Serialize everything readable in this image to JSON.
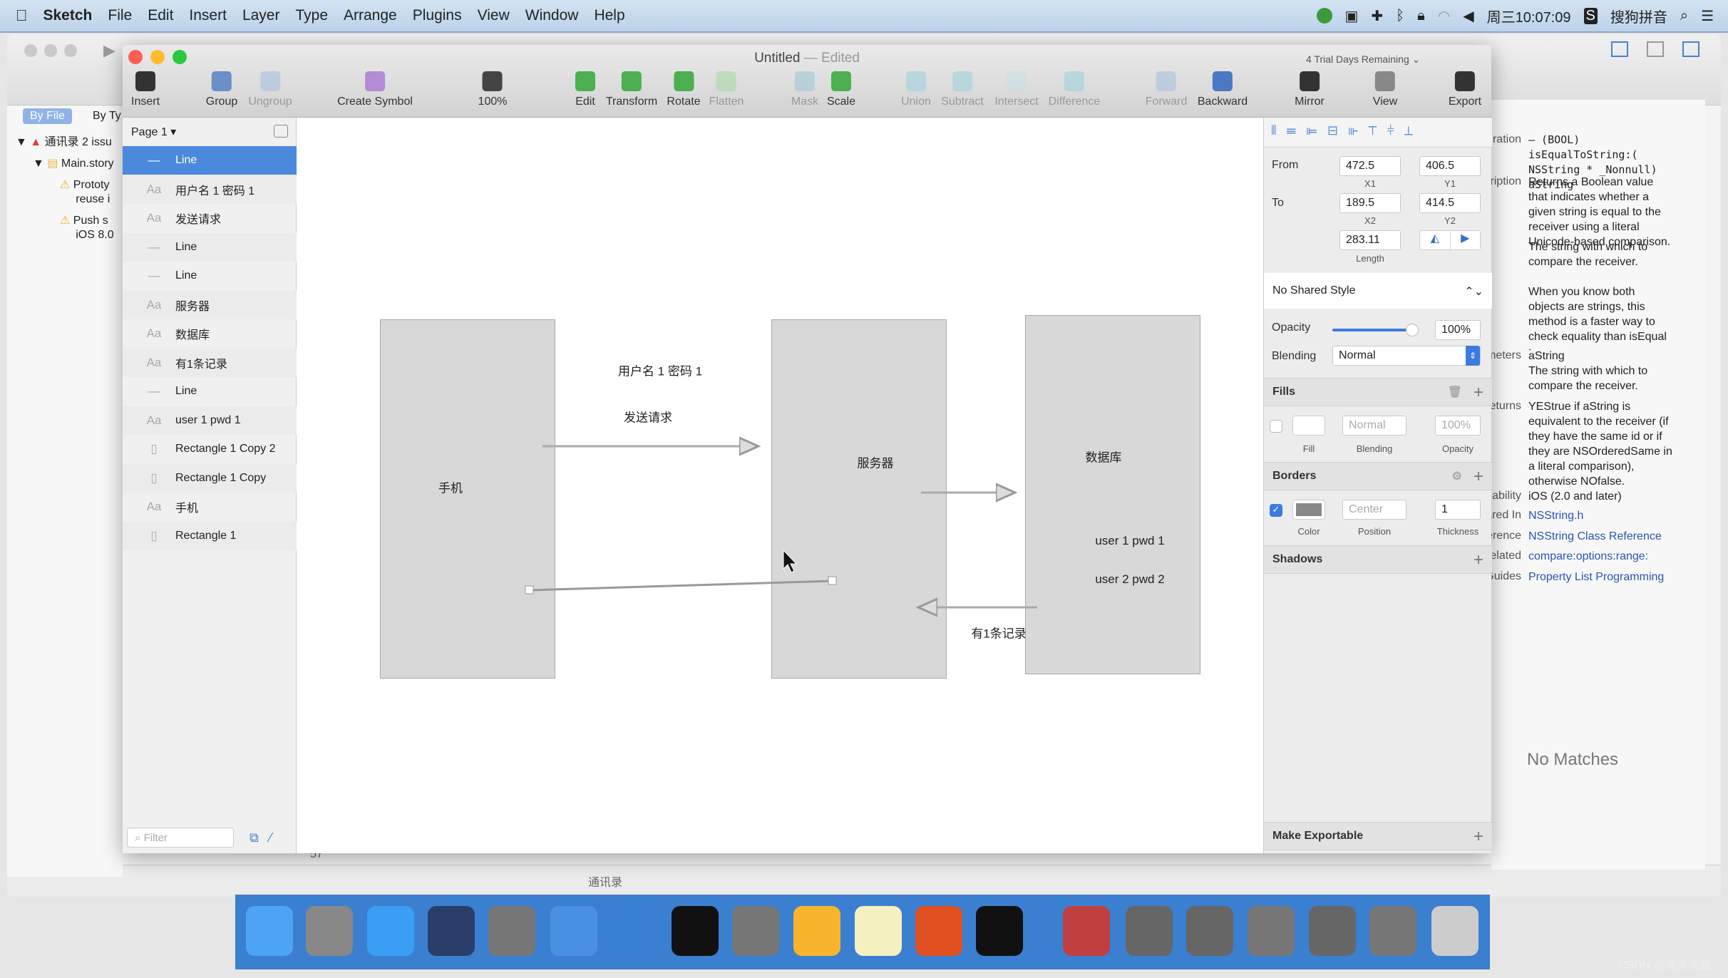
{
  "menubar": {
    "app": "Sketch",
    "items": [
      "File",
      "Edit",
      "Insert",
      "Layer",
      "Type",
      "Arrange",
      "Plugins",
      "View",
      "Window",
      "Help"
    ],
    "clock": "周三10:07:09",
    "ime": "搜狗拼音"
  },
  "window": {
    "title": "Untitled",
    "edited": "— Edited",
    "trial": "4 Trial Days Remaining"
  },
  "toolbar": [
    {
      "label": "Insert",
      "icon": "insert-icon",
      "color": "#333",
      "enabled": true
    },
    {
      "label": "Group",
      "icon": "group-icon",
      "color": "#6b8fc7",
      "enabled": true
    },
    {
      "label": "Ungroup",
      "icon": "ungroup-icon",
      "color": "#a9c0e0",
      "enabled": false
    },
    {
      "label": "Create Symbol",
      "icon": "symbol-icon",
      "color": "#b58ad6",
      "enabled": true
    },
    {
      "label": "100%",
      "icon": "zoom-icon",
      "color": "#444",
      "enabled": true
    },
    {
      "label": "Edit",
      "icon": "edit-icon",
      "color": "#4caf50",
      "enabled": true
    },
    {
      "label": "Transform",
      "icon": "transform-icon",
      "color": "#4caf50",
      "enabled": true
    },
    {
      "label": "Rotate",
      "icon": "rotate-icon",
      "color": "#4caf50",
      "enabled": true
    },
    {
      "label": "Flatten",
      "icon": "flatten-icon",
      "color": "#a8d8a8",
      "enabled": false
    },
    {
      "label": "Mask",
      "icon": "mask-icon",
      "color": "#9ec6d6",
      "enabled": false
    },
    {
      "label": "Scale",
      "icon": "scale-icon",
      "color": "#4caf50",
      "enabled": true
    },
    {
      "label": "Union",
      "icon": "union-icon",
      "color": "#9fd0dc",
      "enabled": false
    },
    {
      "label": "Subtract",
      "icon": "subtract-icon",
      "color": "#9fd0dc",
      "enabled": false
    },
    {
      "label": "Intersect",
      "icon": "intersect-icon",
      "color": "#c8dfe6",
      "enabled": false
    },
    {
      "label": "Difference",
      "icon": "difference-icon",
      "color": "#9fd0dc",
      "enabled": false
    },
    {
      "label": "Forward",
      "icon": "forward-icon",
      "color": "#a9c0e0",
      "enabled": false
    },
    {
      "label": "Backward",
      "icon": "backward-icon",
      "color": "#4a78c4",
      "enabled": true
    },
    {
      "label": "Mirror",
      "icon": "mirror-icon",
      "color": "#333",
      "enabled": true
    },
    {
      "label": "View",
      "icon": "view-icon",
      "color": "#888",
      "enabled": true
    },
    {
      "label": "Export",
      "icon": "export-icon",
      "color": "#333",
      "enabled": true
    }
  ],
  "xcode": {
    "by_file": "By File",
    "by_type": "By Ty",
    "tree": [
      "通讯录 2 issu",
      "Main.story",
      "Prototy",
      "reuse i",
      "Push s",
      "iOS 8.0"
    ],
    "status": "通讯录",
    "line": "57"
  },
  "layers": {
    "page": "Page 1",
    "filter_placeholder": "Filter",
    "items": [
      {
        "type": "line",
        "name": "Line",
        "selected": true
      },
      {
        "type": "text",
        "name": "用户名 1  密码 1"
      },
      {
        "type": "text",
        "name": "发送请求"
      },
      {
        "type": "line",
        "name": "Line"
      },
      {
        "type": "line",
        "name": "Line"
      },
      {
        "type": "text",
        "name": "服务器"
      },
      {
        "type": "text",
        "name": "数据库"
      },
      {
        "type": "text",
        "name": "有1条记录"
      },
      {
        "type": "line",
        "name": "Line"
      },
      {
        "type": "text",
        "name": "user 1  pwd  1"
      },
      {
        "type": "rect",
        "name": "Rectangle 1 Copy 2"
      },
      {
        "type": "rect",
        "name": "Rectangle 1 Copy"
      },
      {
        "type": "text",
        "name": "手机"
      },
      {
        "type": "rect",
        "name": "Rectangle 1"
      }
    ]
  },
  "canvas": {
    "phone": "手机",
    "server": "服务器",
    "database": "数据库",
    "credentials": "用户名 1  密码 1",
    "send_request": "发送请求",
    "user1": "user 1  pwd  1",
    "user2": "user 2  pwd 2",
    "one_record": "有1条记录"
  },
  "inspector": {
    "from": "From",
    "to": "To",
    "x1": "472.5",
    "y1": "406.5",
    "x2": "189.5",
    "y2": "414.5",
    "x1_label": "X1",
    "y1_label": "Y1",
    "x2_label": "X2",
    "y2_label": "Y2",
    "length": "283.11",
    "length_label": "Length",
    "shared_style": "No Shared Style",
    "opacity_label": "Opacity",
    "opacity": "100%",
    "opacity_value": 1.0,
    "blending_label": "Blending",
    "blending": "Normal",
    "fills": {
      "title": "Fills",
      "blending": "Normal",
      "opacity": "100%",
      "fill_label": "Fill",
      "blending_label": "Blending",
      "opacity_label": "Opacity",
      "enabled": false
    },
    "borders": {
      "title": "Borders",
      "position": "Center",
      "thickness": "1",
      "color_label": "Color",
      "position_label": "Position",
      "thickness_label": "Thickness",
      "enabled": true,
      "color": "#888888"
    },
    "shadows": "Shadows",
    "export": "Make Exportable"
  },
  "docs": {
    "sections": [
      {
        "label": "ration",
        "text": "– (BOOL)\nisEqualToString:(\nNSString * _Nonnull)\naString",
        "mono": true
      },
      {
        "label": "ription",
        "text": "Returns a Boolean value\nthat indicates whether a\ngiven string is equal to the\nreceiver using a literal\nUnicode-based comparison."
      },
      {
        "label": "",
        "text": "The string with which to\ncompare the receiver."
      },
      {
        "label": "",
        "text": "When you know both\nobjects are strings, this\nmethod is a faster way to\ncheck equality than isEqual\n:."
      },
      {
        "label": "meters",
        "text": "aString\nThe string with which to\ncompare the receiver."
      },
      {
        "label": "eturns",
        "text": "YEStrue if aString is\nequivalent to the receiver (if\nthey have the same id or if\nthey are NSOrderedSame in\na literal comparison),\notherwise NOfalse."
      },
      {
        "label": "ability",
        "text": "iOS (2.0 and later)"
      },
      {
        "label": "ared In",
        "text": "NSString.h",
        "link": true
      },
      {
        "label": "erence",
        "text": "NSString Class Reference",
        "link": true
      },
      {
        "label": "elated",
        "text": "compare:options:range:",
        "link": true
      },
      {
        "label": "Guides",
        "text": "Property List Programming",
        "link": true
      }
    ],
    "no_matches": "No Matches"
  },
  "watermark": "CSDN @清风清晨",
  "colors": {
    "selection": "#4a89dc",
    "dock": "#3b7fd0",
    "shape_fill": "#d8d8d8"
  }
}
